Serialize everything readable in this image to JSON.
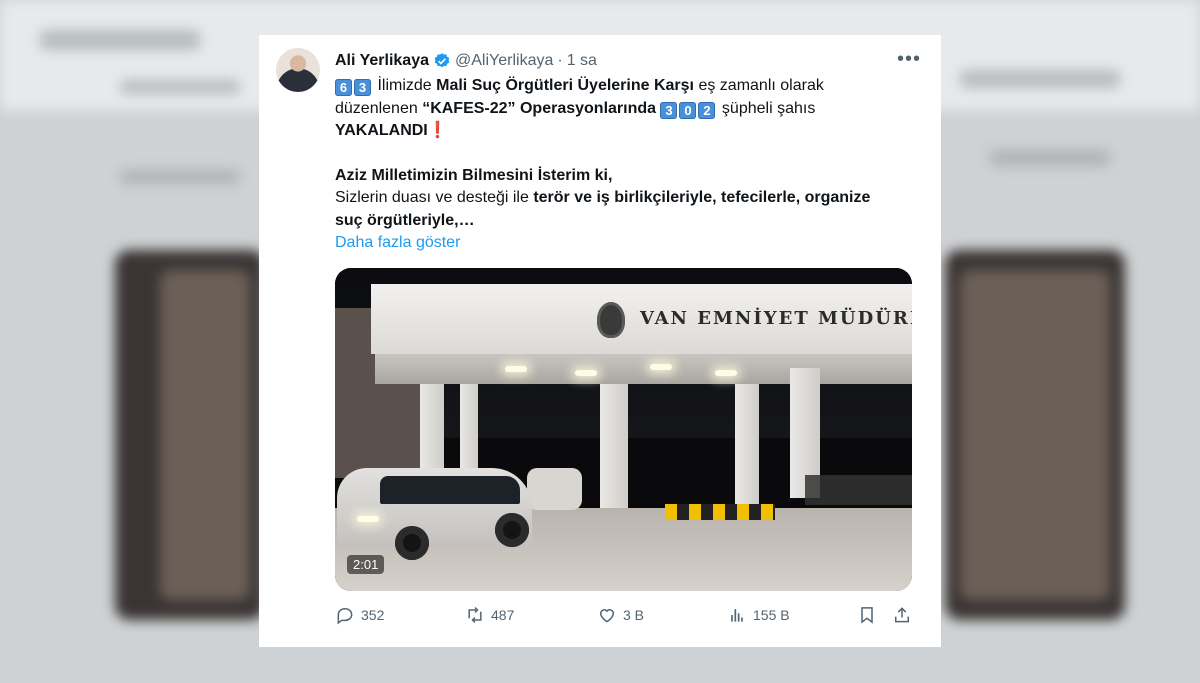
{
  "tweet": {
    "author_name": "Ali Yerlikaya",
    "handle": "@AliYerlikaya",
    "separator": "·",
    "time": "1 sa",
    "more_label": "•••",
    "text": {
      "l1_k1": "6",
      "l1_k2": "3",
      "l1_a": " İlimizde ",
      "l1_b": "Mali Suç Örgütleri Üyelerine Karşı",
      "l1_c": " eş zamanlı olarak",
      "l2_a": "düzenlenen ",
      "l2_b": "“KAFES-22” Operasyonlarında",
      "l2_k1": "3",
      "l2_k2": "0",
      "l2_k3": "2",
      "l2_c": " şüpheli şahıs",
      "l3_a": "YAKALANDI",
      "l3_excl": "❗",
      "l4": "Aziz Milletimizin Bilmesini İsterim ki,",
      "l5_a": "Sizlerin duası ve desteği ile ",
      "l5_b": "terör ve iş birlikçileriyle, tefecilerle, organize",
      "l6": "suç örgütleriyle,…"
    },
    "show_more": "Daha fazla göster"
  },
  "video": {
    "sign_text": "VAN EMNİYET MÜDÜRL",
    "duration": "2:01"
  },
  "actions": {
    "replies": "352",
    "reposts": "487",
    "likes": "3 B",
    "views": "155 B"
  },
  "colors": {
    "accent": "#1d9bf0",
    "text": "#0f1419",
    "muted": "#536471",
    "keycap": "#4a90d9"
  }
}
